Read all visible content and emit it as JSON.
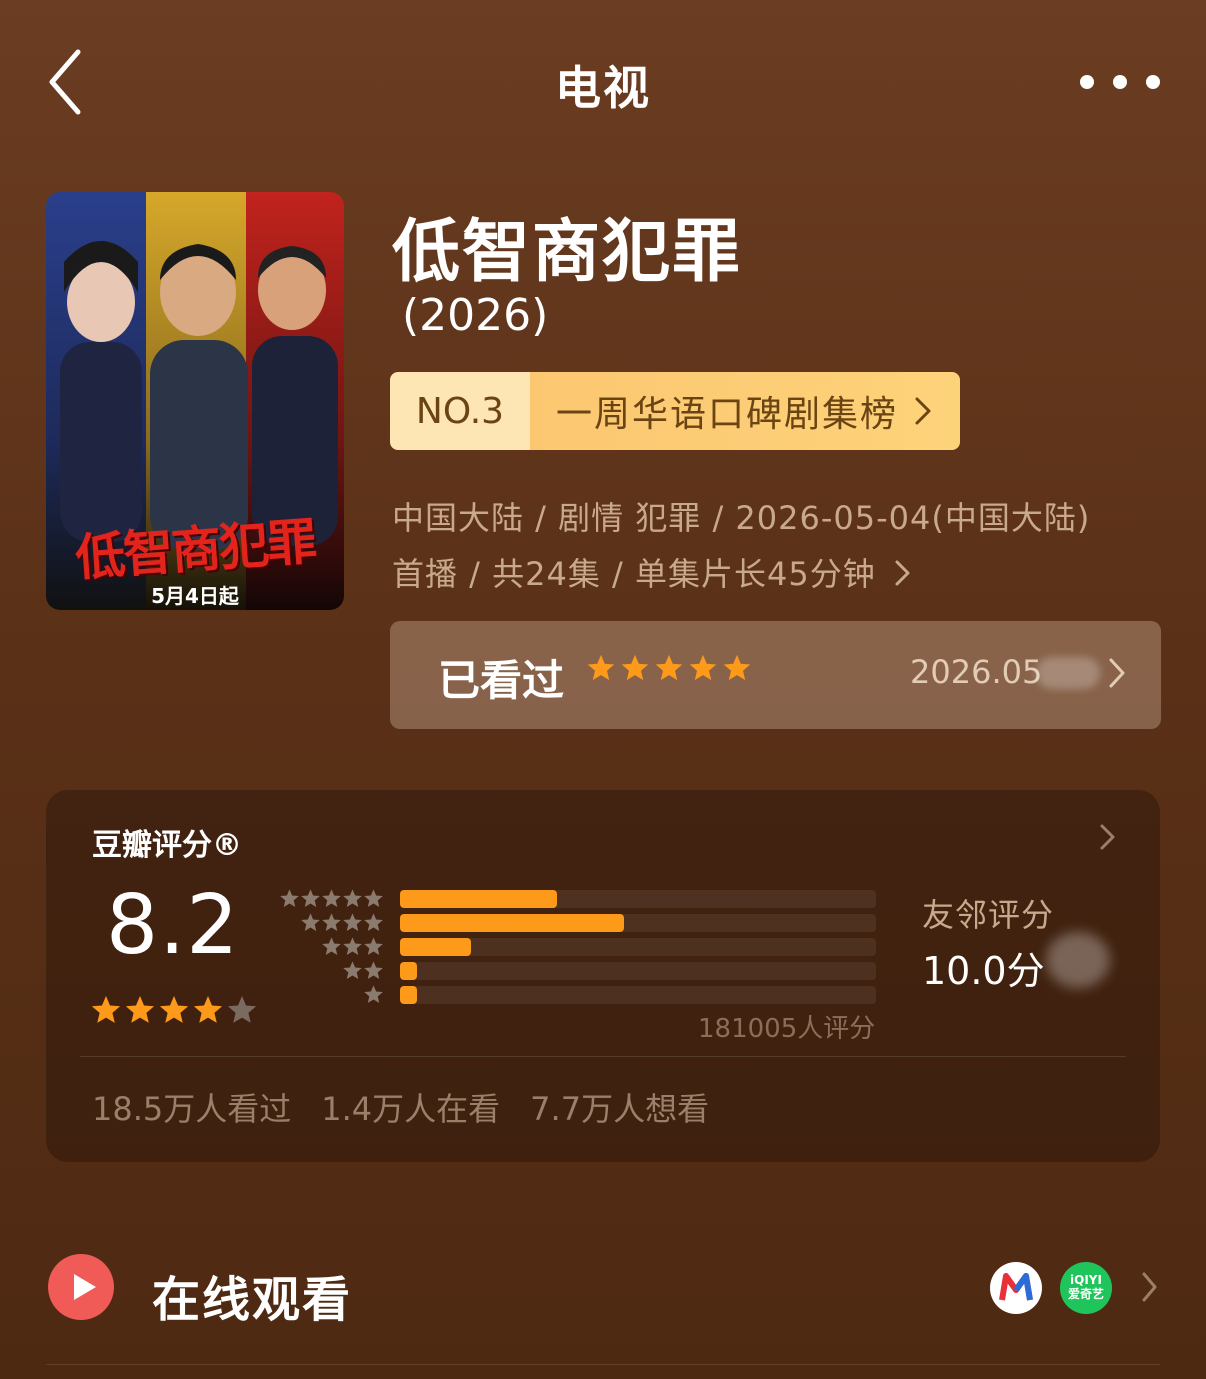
{
  "header": {
    "title": "电视"
  },
  "poster": {
    "title": "低智商犯罪",
    "date": "5月4日起"
  },
  "show": {
    "title": "低智商犯罪",
    "year": "(2026)"
  },
  "rank": {
    "no": "NO.3",
    "label": "一周华语口碑剧集榜"
  },
  "meta": {
    "line": "中国大陆 / 剧情 犯罪 / 2026-05-04(中国大陆) 首播 / 共24集 / 单集片长45分钟"
  },
  "watched": {
    "label": "已看过",
    "stars": 5,
    "date": "2026.05"
  },
  "rating": {
    "title": "豆瓣评分®",
    "score": "8.2",
    "stars": 4,
    "distribution": [
      {
        "stars": 5,
        "fraction": 0.33
      },
      {
        "stars": 4,
        "fraction": 0.47
      },
      {
        "stars": 3,
        "fraction": 0.15
      },
      {
        "stars": 2,
        "fraction": 0.03
      },
      {
        "stars": 1,
        "fraction": 0.03
      }
    ],
    "count": "181005人评分",
    "friend_label": "友邻评分",
    "friend_score": "10.0分",
    "stats": [
      "18.5万人看过",
      "1.4万人在看",
      "7.7万人想看"
    ]
  },
  "online": {
    "label": "在线观看",
    "providers": [
      "mango-icon",
      "iqiyi-icon"
    ],
    "iqiyi_text_1": "iQIYI",
    "iqiyi_text_2": "爱奇艺"
  },
  "colors": {
    "accent": "#fd9a1a",
    "star": "#fd9a1a",
    "play": "#f05a57"
  }
}
